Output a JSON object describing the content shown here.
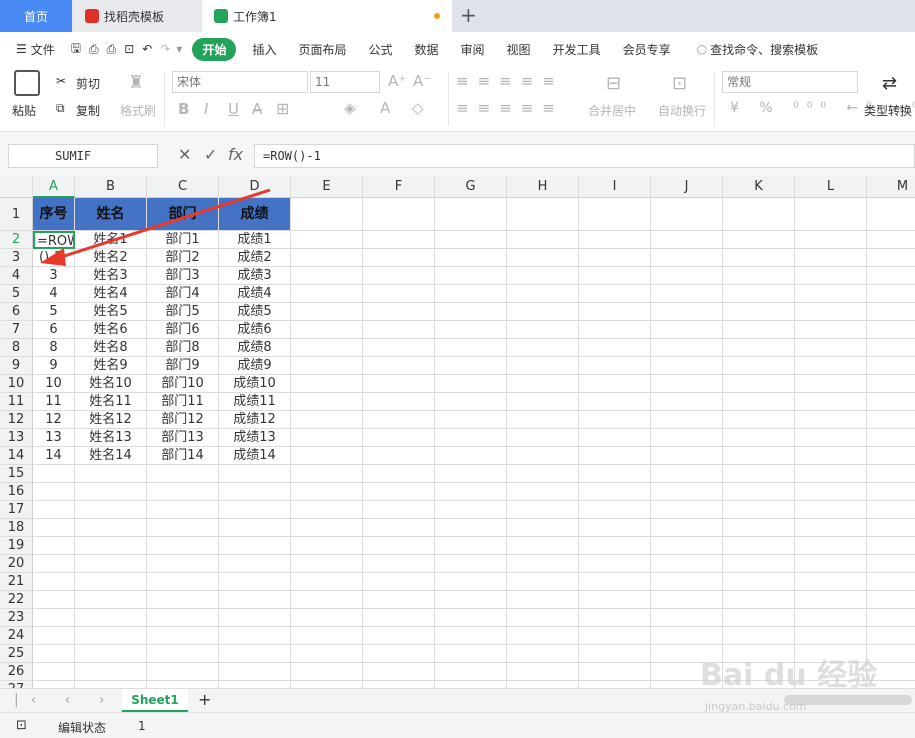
{
  "tabs": {
    "home": "首页",
    "template": "找稻壳模板",
    "workbook": "工作簿1",
    "plus": "+"
  },
  "menu": {
    "file": "文件",
    "start": "开始",
    "insert": "插入",
    "layout": "页面布局",
    "formula": "公式",
    "data": "数据",
    "review": "审阅",
    "view": "视图",
    "dev": "开发工具",
    "member": "会员专享",
    "search": "查找命令、搜索模板"
  },
  "ribbon": {
    "paste": "粘贴",
    "cut": "剪切",
    "copy": "复制",
    "format_painter": "格式刷",
    "font": "宋体",
    "size": "11",
    "merge": "合并居中",
    "wrap": "自动换行",
    "numfmt": "常规",
    "typeconv": "类型转换",
    "bold": "B",
    "italic": "I",
    "underline": "U"
  },
  "formula_bar": {
    "name_box": "SUMIF",
    "formula": "=ROW()-1",
    "fx": "fx"
  },
  "columns": [
    "A",
    "B",
    "C",
    "D",
    "E",
    "F",
    "G",
    "H",
    "I",
    "J",
    "K",
    "L",
    "M"
  ],
  "rows": [
    "1",
    "2",
    "3",
    "4",
    "5",
    "6",
    "7",
    "8",
    "9",
    "10",
    "11",
    "12",
    "13",
    "14",
    "15",
    "16",
    "17",
    "18",
    "19",
    "20",
    "21",
    "22",
    "23",
    "24",
    "25",
    "26",
    "27"
  ],
  "table": {
    "header": [
      "序号",
      "姓名",
      "部门",
      "成绩"
    ],
    "edit_cell_line1": "=ROW",
    "edit_cell_line2": "()-1",
    "data_rows": [
      [
        "",
        "姓名1",
        "部门1",
        "成绩1"
      ],
      [
        "",
        "姓名2",
        "部门2",
        "成绩2"
      ],
      [
        "3",
        "姓名3",
        "部门3",
        "成绩3"
      ],
      [
        "4",
        "姓名4",
        "部门4",
        "成绩4"
      ],
      [
        "5",
        "姓名5",
        "部门5",
        "成绩5"
      ],
      [
        "6",
        "姓名6",
        "部门6",
        "成绩6"
      ],
      [
        "8",
        "姓名8",
        "部门8",
        "成绩8"
      ],
      [
        "9",
        "姓名9",
        "部门9",
        "成绩9"
      ],
      [
        "10",
        "姓名10",
        "部门10",
        "成绩10"
      ],
      [
        "11",
        "姓名11",
        "部门11",
        "成绩11"
      ],
      [
        "12",
        "姓名12",
        "部门12",
        "成绩12"
      ],
      [
        "13",
        "姓名13",
        "部门13",
        "成绩13"
      ],
      [
        "14",
        "姓名14",
        "部门14",
        "成绩14"
      ]
    ]
  },
  "sheet": {
    "name": "Sheet1",
    "add": "+"
  },
  "status": {
    "mode": "编辑状态",
    "value": "1"
  },
  "watermark": {
    "brand": "Bai du 经验",
    "url": "jingyan.baidu.com"
  },
  "colors": {
    "accent": "#22a35a",
    "header_fill": "#4472c4",
    "arrow": "#e8392b",
    "tab_active": "#4a8af4"
  }
}
